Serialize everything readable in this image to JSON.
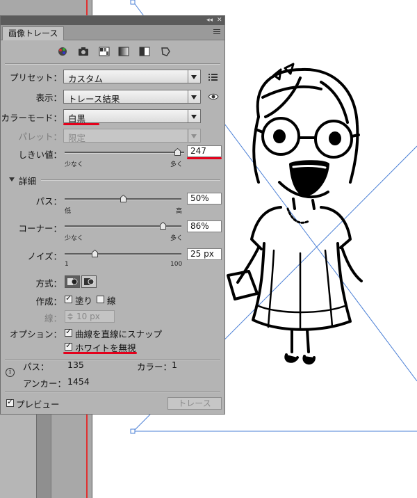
{
  "panel": {
    "tab_title": "画像トレース",
    "collapse_glyph": "◂◂",
    "close_glyph": "✕"
  },
  "presets": {
    "preset_label": "プリセット：",
    "preset_value": "カスタム",
    "view_label": "表示：",
    "view_value": "トレース結果",
    "mode_label": "カラーモード：",
    "mode_value": "白黒",
    "palette_label": "パレット：",
    "palette_value": "限定",
    "threshold_label": "しきい値：",
    "threshold_value": "247",
    "threshold_level": 247,
    "threshold_max": 255,
    "threshold_low": "少なく",
    "threshold_high": "多く"
  },
  "advanced": {
    "header_label": "詳細",
    "paths_label": "パス：",
    "paths_value": "50%",
    "paths_level": 0.5,
    "paths_low": "低",
    "paths_high": "高",
    "corners_label": "コーナー：",
    "corners_value": "86%",
    "corners_level": 0.86,
    "corners_low": "少なく",
    "corners_high": "多く",
    "noise_label": "ノイズ：",
    "noise_value": "25 px",
    "noise_level": 25,
    "noise_min_label": "1",
    "noise_max_label": "100",
    "method_label": "方式：",
    "create_label": "作成：",
    "fills_label": "塗り",
    "strokes_label": "線",
    "stroke_label": "線：",
    "stroke_value": "10 px",
    "options_label": "オプション：",
    "snap_label": "曲線を直線にスナップ",
    "ignore_white_label": "ホワイトを無視"
  },
  "stats": {
    "paths_label": "パス：",
    "paths_value": "135",
    "colors_label": "カラー：",
    "colors_value": "1",
    "anchors_label": "アンカー：",
    "anchors_value": "1454",
    "info_glyph": "i"
  },
  "footer": {
    "preview_label": "プレビュー",
    "trace_button_label": "トレース"
  },
  "colors": {
    "panel_bg": "#b4b4b4",
    "panel_topbar": "#5b5b5b",
    "annotation_red": "#e4001b",
    "guide_blue": "#4a7fd6"
  }
}
